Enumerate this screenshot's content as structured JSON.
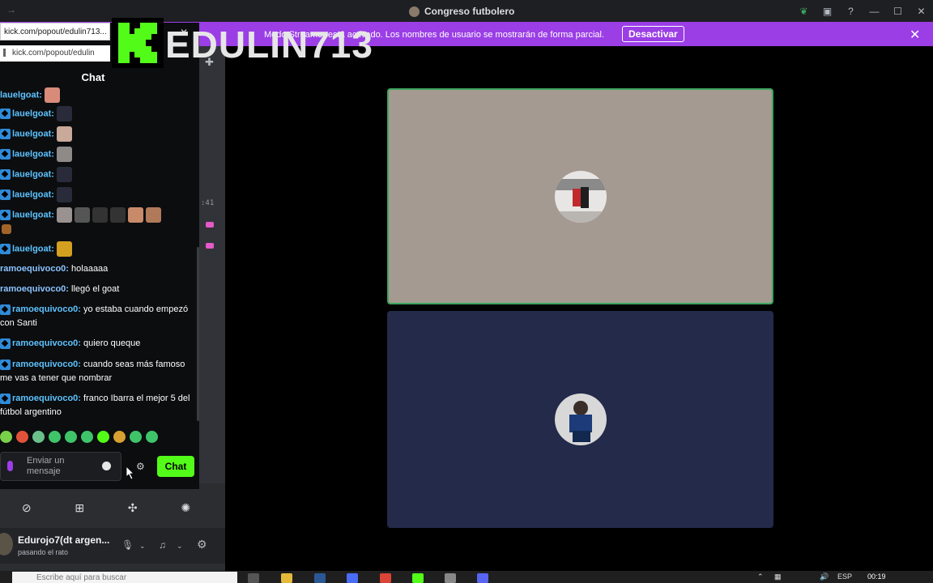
{
  "window": {
    "title": "Congreso futbolero"
  },
  "banner": {
    "message": "Modo Streamer está activado. Los nombres de usuario se mostrarán de forma parcial.",
    "button": "Desactivar",
    "bg_color": "#9b3ee6"
  },
  "popout": {
    "url_full": "kick.com/popout/edulin713...",
    "url_short": "kick.com/popout/edulin",
    "streamer": "EDULIN713",
    "chat_title": "Chat",
    "messages": [
      {
        "user": "lauelgoat:",
        "text": "",
        "emotes": 1
      },
      {
        "user": "lauelgoat:",
        "text": "",
        "emotes": 1
      },
      {
        "user": "lauelgoat:",
        "text": "",
        "emotes": 1
      },
      {
        "user": "lauelgoat:",
        "text": "",
        "emotes": 1
      },
      {
        "user": "lauelgoat:",
        "text": "",
        "emotes": 1
      },
      {
        "user": "lauelgoat:",
        "text": "",
        "emotes": 1
      },
      {
        "user": "lauelgoat:",
        "text": "",
        "emotes": 6
      },
      {
        "user": "lauelgoat:",
        "text": "",
        "emotes": 1
      },
      {
        "user": "ramoequivoco0:",
        "text": " holaaaaa"
      },
      {
        "user": "ramoequivoco0:",
        "text": " llegó el goat"
      },
      {
        "user": "ramoequivoco0:",
        "text": " yo estaba cuando empezó con Santi"
      },
      {
        "user": "ramoequivoco0:",
        "text": " quiero queque"
      },
      {
        "user": "ramoequivoco0:",
        "text": " cuando seas más famoso me vas a tener que nombrar"
      },
      {
        "user": "ramoequivoco0:",
        "text": " franco Ibarra el mejor 5 del fútbol argentino"
      }
    ],
    "input_placeholder": "Enviar un mensaje",
    "send_button": "Chat",
    "accent": "#53fc18"
  },
  "sidebar": {
    "timestamp": ":41"
  },
  "user": {
    "name": "Edurojo7(dt argen...",
    "status": "pasando el rato"
  },
  "taskbar": {
    "search_placeholder": "Escribe aquí para buscar",
    "lang": "ESP",
    "time": "00:19"
  }
}
